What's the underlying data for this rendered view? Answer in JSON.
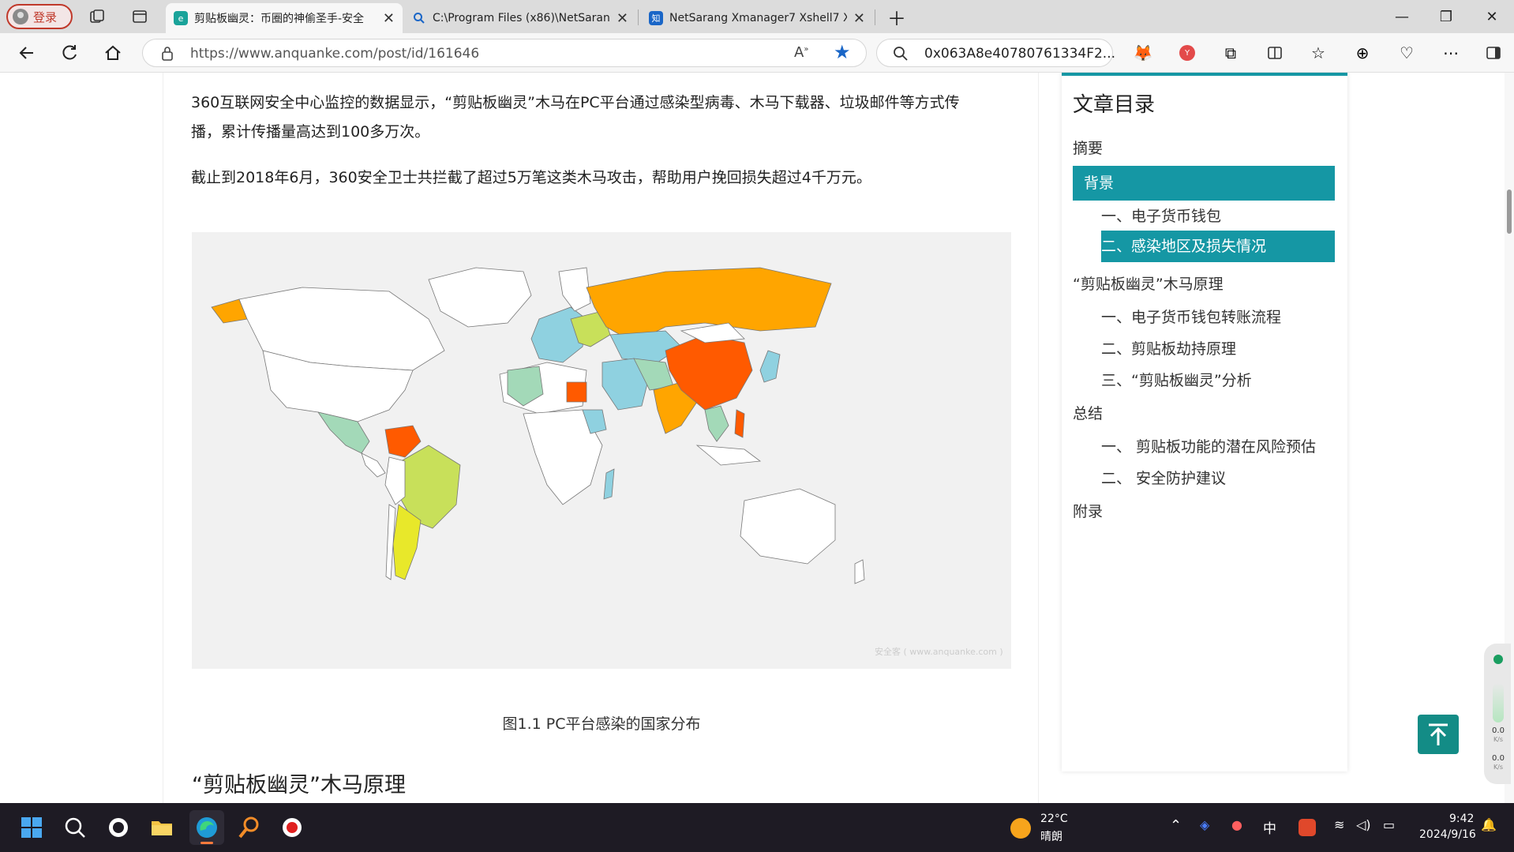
{
  "browser": {
    "login_label": "登录",
    "tabs": [
      {
        "title": "剪贴板幽灵：币圈的神偷圣手-安全",
        "active": true,
        "favicon": "anquanke-icon"
      },
      {
        "title": "C:\\Program Files (x86)\\NetSarang",
        "active": false,
        "favicon": "search-icon"
      },
      {
        "title": "NetSarang Xmanager7 Xshell7 Xft",
        "active": false,
        "favicon": "zhihu-icon"
      }
    ],
    "url": "https://www.anquanke.com/post/id/161646",
    "search_text": "0x063A8e40780761334F2..."
  },
  "article": {
    "paragraph1": "360互联网安全中心监控的数据显示，“剪贴板幽灵”木马在PC平台通过感染型病毒、木马下载器、垃圾邮件等方式传",
    "paragraph1_cont": "播，累计传播量高达到100多万次。",
    "paragraph2": "截止到2018年6月，360安全卫士共拦截了超过5万笔这类木马攻击，帮助用户挽回损失超过4千万元。",
    "figure_caption": "图1.1 PC平台感染的国家分布",
    "watermark": "安全客 ( www.anquanke.com )",
    "section_heading": "“剪贴板幽灵”木马原理"
  },
  "toc": {
    "title": "文章目录",
    "items": [
      {
        "label": "摘要",
        "level": 1,
        "active": false
      },
      {
        "label": "背景",
        "level": 1,
        "active": true
      },
      {
        "label": "一、电子货币钱包",
        "level": 2,
        "active": false
      },
      {
        "label": "二、感染地区及损失情况",
        "level": 2,
        "active": true
      },
      {
        "label": "“剪贴板幽灵”木马原理",
        "level": 1,
        "active": false
      },
      {
        "label": "一、电子货币钱包转账流程",
        "level": 2,
        "active": false
      },
      {
        "label": "二、剪贴板劫持原理",
        "level": 2,
        "active": false
      },
      {
        "label": "三、“剪贴板幽灵”分析",
        "level": 2,
        "active": false
      },
      {
        "label": "总结",
        "level": 1,
        "active": false
      },
      {
        "label": "一、 剪贴板功能的潜在风险预估",
        "level": 2,
        "active": false
      },
      {
        "label": "二、 安全防护建议",
        "level": 2,
        "active": false
      },
      {
        "label": "附录",
        "level": 1,
        "active": false
      }
    ]
  },
  "net_widget": {
    "up": "0.0",
    "up_unit": "K/s",
    "down": "0.0",
    "down_unit": "K/s"
  },
  "taskbar": {
    "weather_temp": "22°C",
    "weather_desc": "晴朗",
    "ime": "中",
    "time": "9:42",
    "date": "2024/9/16"
  },
  "colors": {
    "accent": "#1597a4",
    "map_high": "#ff5a00",
    "map_mid_high": "#ffa500",
    "map_mid": "#c8e05a",
    "map_low": "#8fd1e0",
    "map_lowest": "#a3d9b8"
  }
}
